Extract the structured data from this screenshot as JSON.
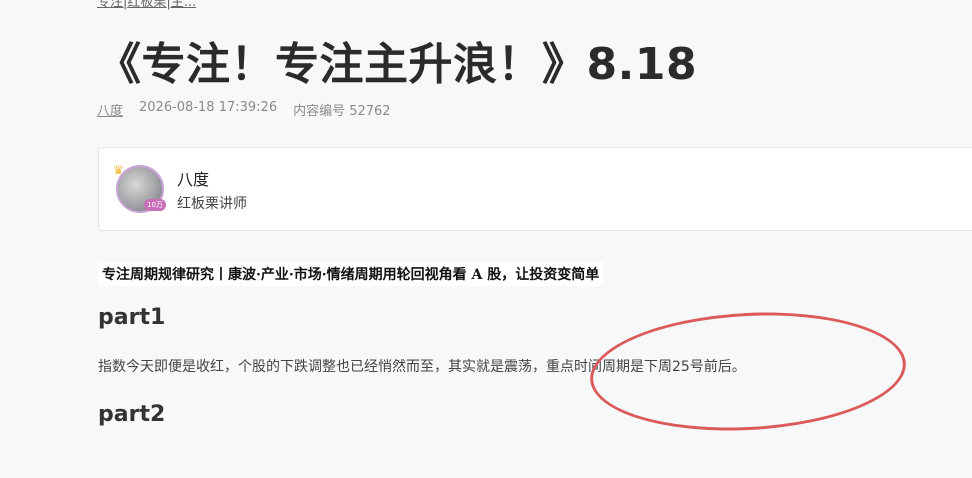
{
  "breadcrumb": "专注|红板栗|主...",
  "article": {
    "title": "《专注！专注主升浪！》8.18",
    "meta": {
      "author": "八度",
      "datetime": "2026-08-18 17:39:26",
      "content_id": "内容编号 52762"
    }
  },
  "author_card": {
    "name": "八度",
    "role": "红板栗讲师",
    "badge": "10万",
    "avatar_icon": "crown-icon"
  },
  "body": {
    "tagline": "专注周期规律研究丨康波·产业·市场·情绪周期用轮回视角看 A 股，让投资变简单",
    "sections": [
      {
        "heading": "part1",
        "text": "指数今天即便是收红，个股的下跌调整也已经悄然而至，其实就是震荡，重点时间周期是下周25号前后。"
      },
      {
        "heading": "part2",
        "text": ""
      }
    ]
  },
  "annotation": {
    "color": "#dc5a5a",
    "shape": "ellipse"
  }
}
